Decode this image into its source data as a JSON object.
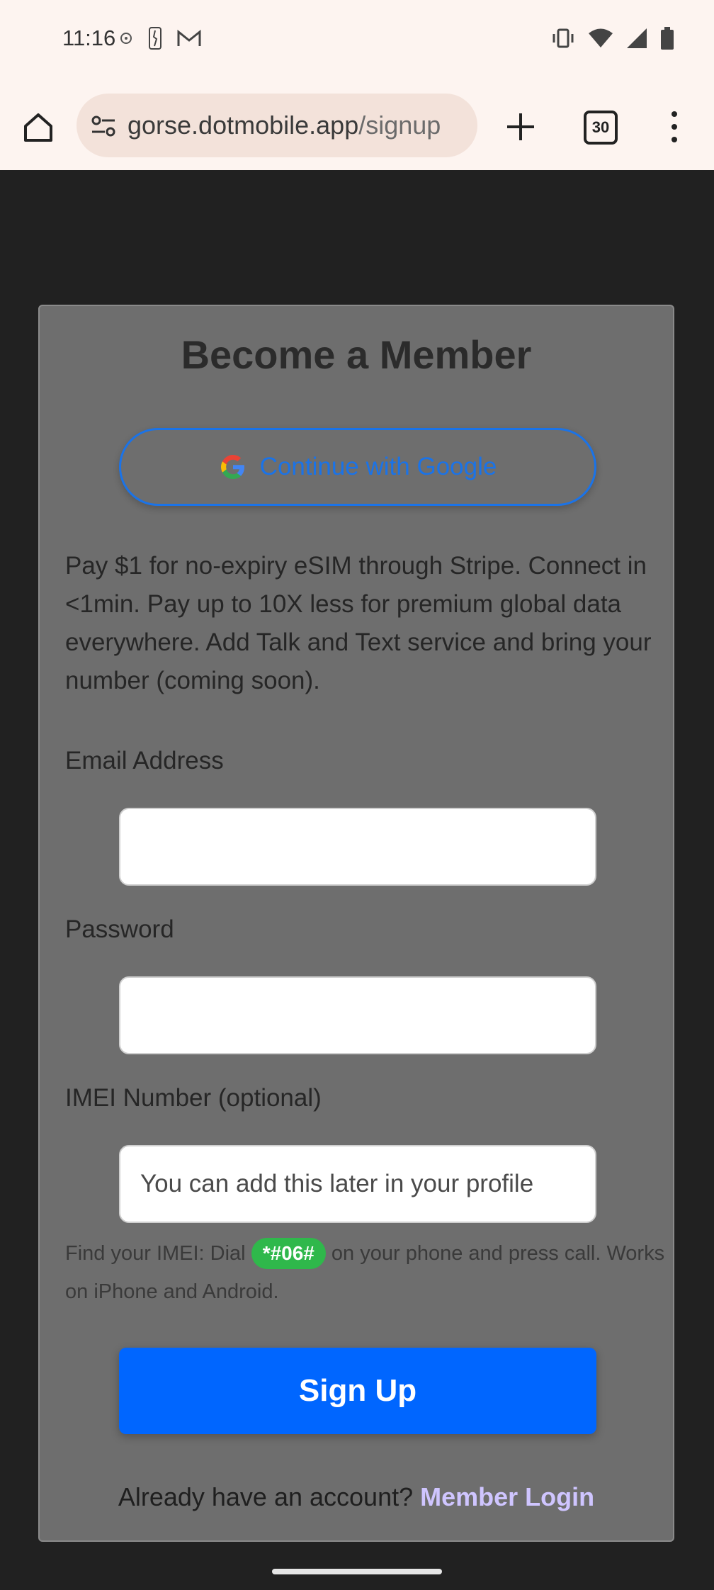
{
  "status_bar": {
    "time": "11:16"
  },
  "browser": {
    "url_domain": "gorse.dotmobile.app",
    "url_path": "/signup",
    "tab_count": "30"
  },
  "card": {
    "title": "Become a Member",
    "google_button_label": "Continue with Google",
    "intro_text": "Pay $1 for no-expiry eSIM through Stripe. Connect in <1min. Pay up to 10X less for premium global data everywhere. Add Talk and Text service and bring your number (coming soon).",
    "email_label": "Email Address",
    "email_value": "",
    "password_label": "Password",
    "password_value": "",
    "imei_label": "IMEI Number (optional)",
    "imei_placeholder": "You can add this later in your profile",
    "hint_prefix": "Find your IMEI: Dial ",
    "hint_code": "*#06#",
    "hint_suffix": " on your phone and press call. Works on iPhone and Android.",
    "signup_label": "Sign Up",
    "login_prompt": "Already have an account?",
    "login_link": "Member Login"
  },
  "colors": {
    "accent": "#0066ff",
    "google_blue": "#1a73e8",
    "code_badge": "#2fb84b",
    "card_bg": "#6e6e6e",
    "page_bg": "#212121"
  }
}
